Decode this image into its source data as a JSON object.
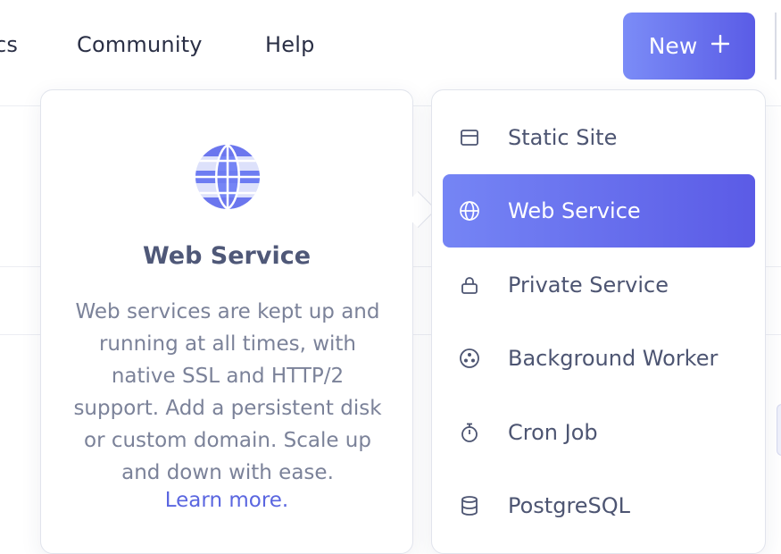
{
  "nav": {
    "partial_item": "cs",
    "community": "Community",
    "help": "Help"
  },
  "new_button": {
    "label": "New",
    "icon": "plus-icon"
  },
  "info_panel": {
    "icon": "globe-icon",
    "title": "Web Service",
    "description": "Web services are kept up and running at all times, with native SSL and HTTP/2 support. Add a persistent disk or custom domain. Scale up and down with ease.",
    "link_label": "Learn more."
  },
  "menu": {
    "items": [
      {
        "label": "Static Site",
        "icon": "browser-window-icon"
      },
      {
        "label": "Web Service",
        "icon": "globe-icon",
        "active": true
      },
      {
        "label": "Private Service",
        "icon": "lock-icon"
      },
      {
        "label": "Background Worker",
        "icon": "worker-icon"
      },
      {
        "label": "Cron Job",
        "icon": "stopwatch-icon"
      },
      {
        "label": "PostgreSQL",
        "icon": "database-icon"
      }
    ]
  },
  "colors": {
    "accent_start": "#7b8cf7",
    "accent_end": "#5a5ce6",
    "link": "#5a66e0",
    "heading": "#4f5878",
    "body_text": "#7b8299"
  }
}
